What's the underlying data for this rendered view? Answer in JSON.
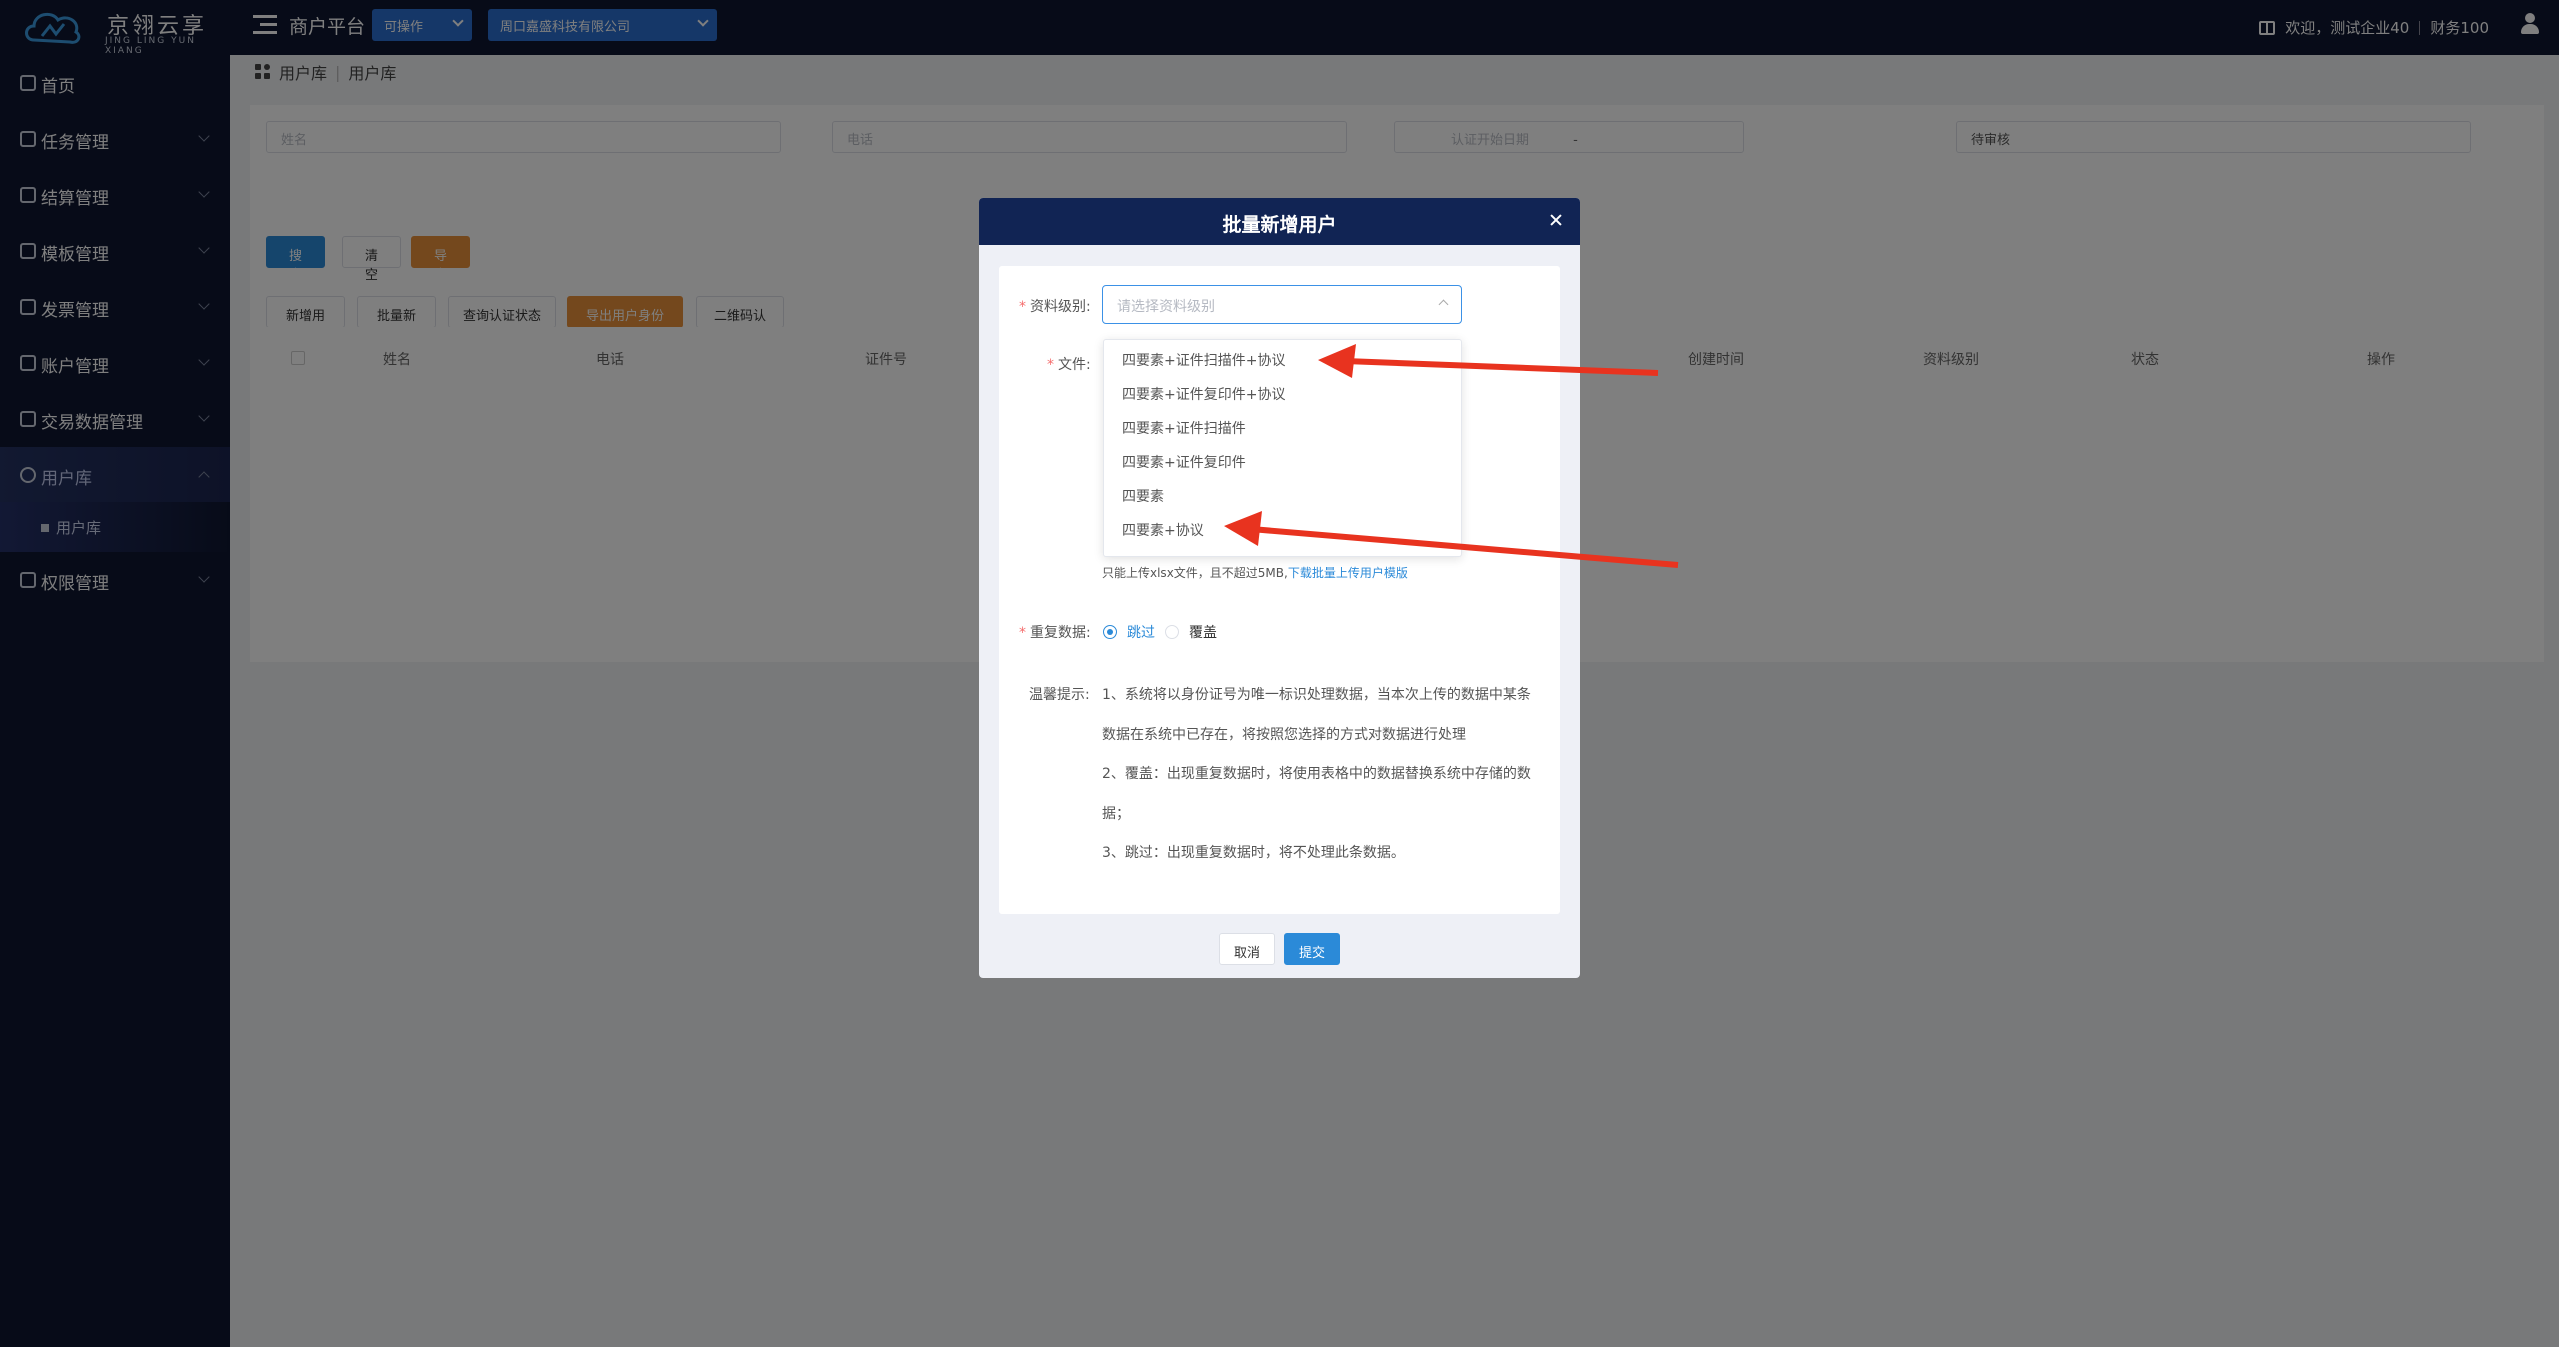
{
  "brand": {
    "title": "京翎云享",
    "subtitle": "JING LING YUN XIANG"
  },
  "header": {
    "platform": "商户平台",
    "mode_select": "可操作",
    "company_select": "周口嘉盛科技有限公司",
    "welcome": "欢迎，测试企业40",
    "role": "财务100"
  },
  "sidebar": {
    "items": [
      {
        "label": "首页"
      },
      {
        "label": "任务管理"
      },
      {
        "label": "结算管理"
      },
      {
        "label": "模板管理"
      },
      {
        "label": "发票管理"
      },
      {
        "label": "账户管理"
      },
      {
        "label": "交易数据管理"
      },
      {
        "label": "用户库"
      },
      {
        "label": "权限管理"
      }
    ],
    "sub_item": "用户库"
  },
  "breadcrumb": {
    "root": "用户库",
    "separator": "|",
    "current": "用户库"
  },
  "filters": {
    "name_placeholder": "姓名",
    "phone_placeholder": "电话",
    "date_start_placeholder": "认证开始日期",
    "date_separator": "-",
    "status_value": "待审核"
  },
  "buttons": {
    "search": "搜 索",
    "clear": "清 空",
    "export": "导 出",
    "add_user": "新增用户",
    "batch_add": "批量新增",
    "query_status": "查询认证状态",
    "export_id": "导出用户身份证",
    "qr_auth": "二维码认证"
  },
  "table": {
    "columns": [
      "姓名",
      "电话",
      "证件号",
      "创建时间",
      "资料级别",
      "状态",
      "操作"
    ]
  },
  "dialog": {
    "title": "批量新增用户",
    "level_label": "资料级别:",
    "level_placeholder": "请选择资料级别",
    "file_label": "文件:",
    "level_options": [
      "四要素+证件扫描件+协议",
      "四要素+证件复印件+协议",
      "四要素+证件扫描件",
      "四要素+证件复印件",
      "四要素",
      "四要素+协议"
    ],
    "upload_hint": "只能上传xlsx文件，且不超过5MB,",
    "template_link": "下载批量上传用户模版",
    "duplicate_label": "重复数据:",
    "duplicate_options": [
      "跳过",
      "覆盖"
    ],
    "duplicate_selected": "跳过",
    "tips_label": "温馨提示:",
    "tips": [
      "1、系统将以身份证号为唯一标识处理数据，当本次上传的数据中某条",
      "数据在系统中已存在，将按照您选择的方式对数据进行处理",
      "2、覆盖：出现重复数据时，将使用表格中的数据替换系统中存储的数",
      "据；",
      "3、跳过：出现重复数据时，将不处理此条数据。"
    ],
    "cancel": "取消",
    "submit": "提交"
  },
  "colors": {
    "nav_bg": "#0f1731",
    "primary": "#2b8ad8",
    "orange": "#e8913b",
    "dialog_header": "#112454",
    "arrow": "#e8331f"
  }
}
